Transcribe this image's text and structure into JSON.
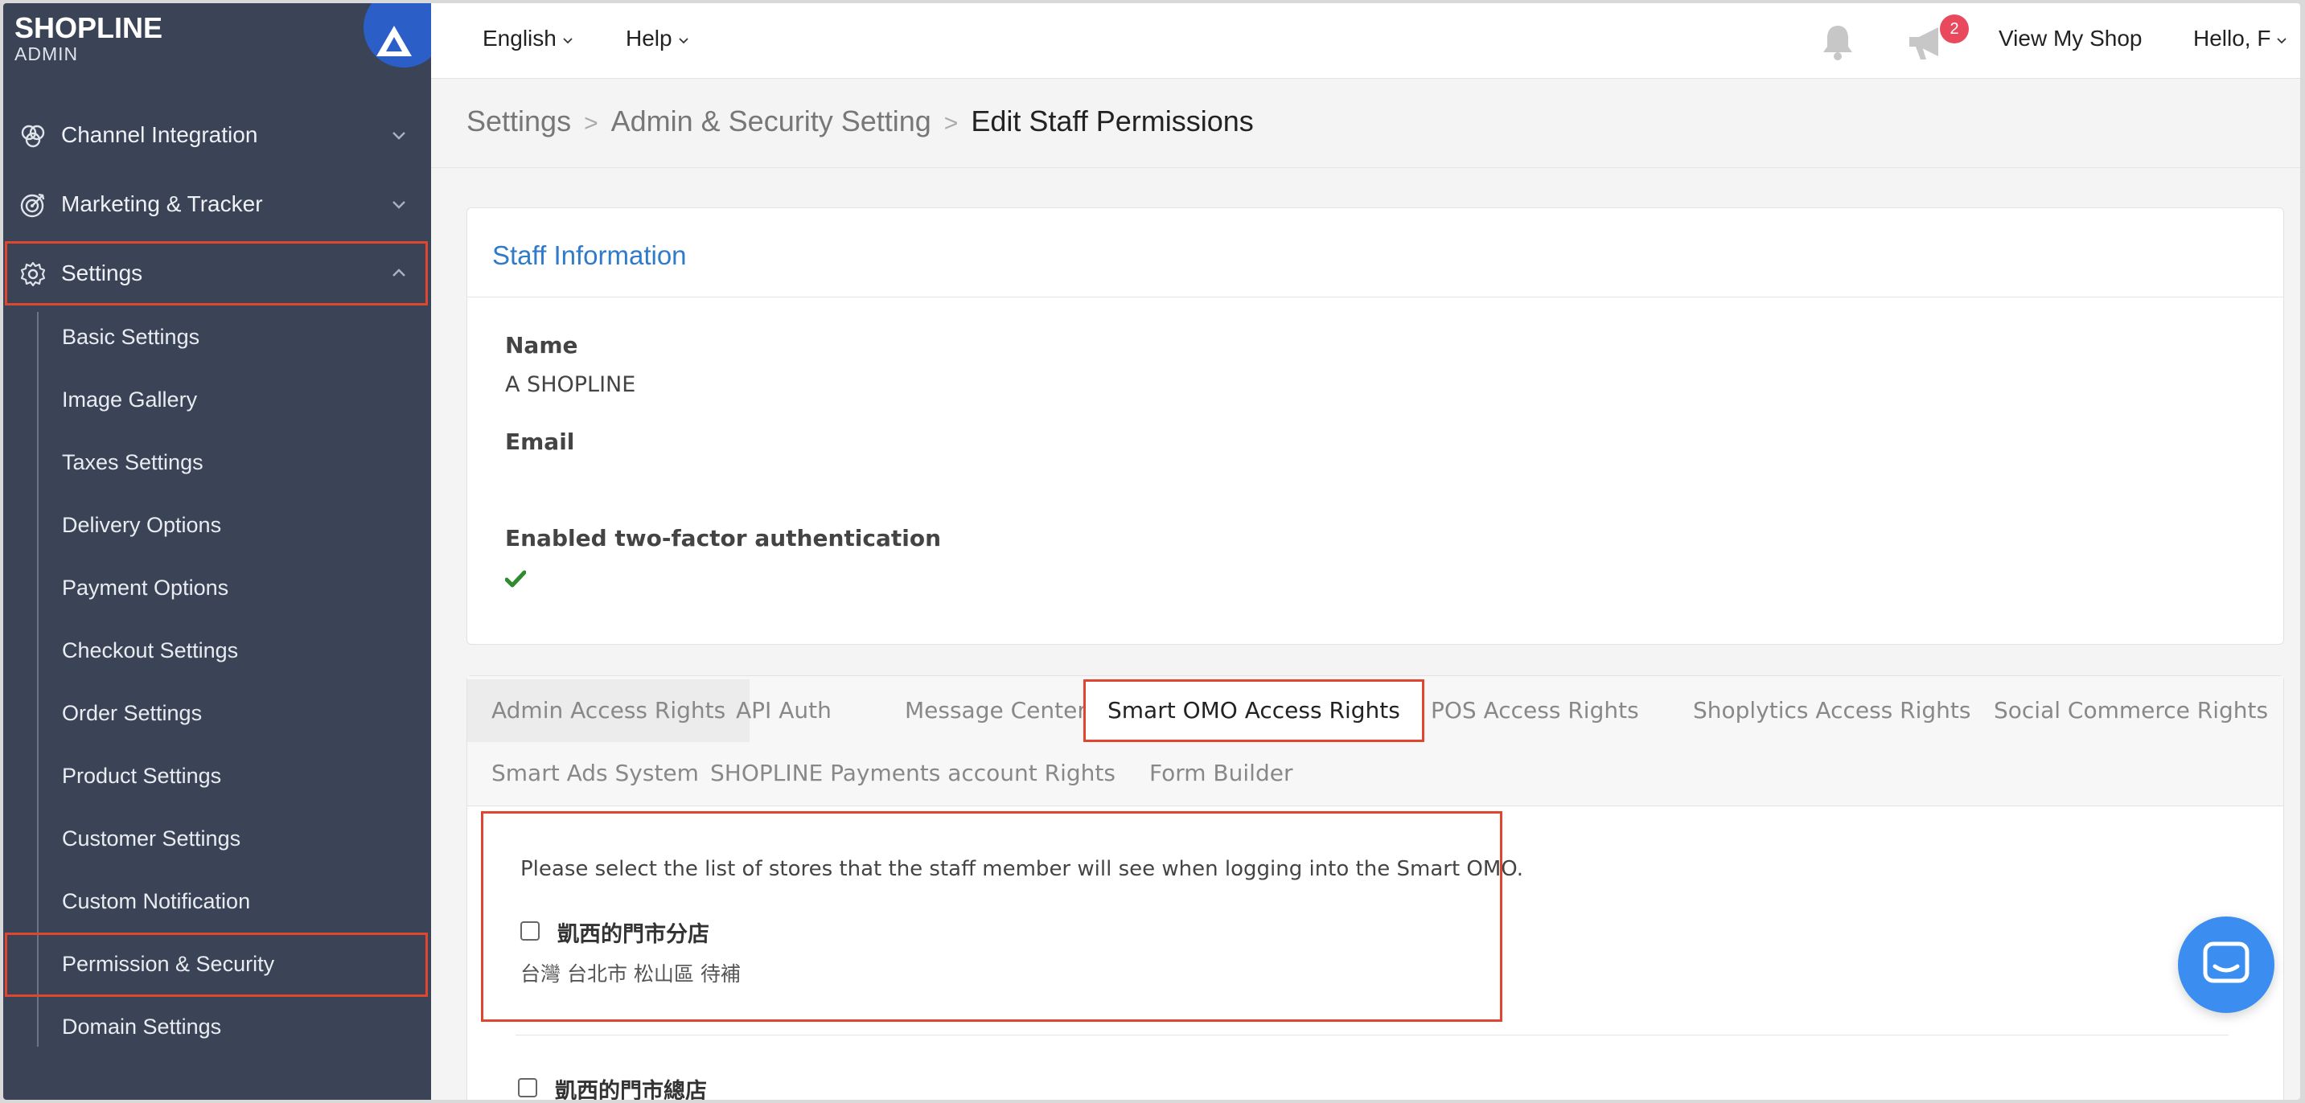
{
  "app": {
    "brand": "SHOPLINE",
    "brand_sub": "ADMIN"
  },
  "sidebar": {
    "sections": [
      {
        "label": "Channel Integration",
        "icon": "channel-integration-icon",
        "expanded": false
      },
      {
        "label": "Marketing & Tracker",
        "icon": "target-icon",
        "expanded": false
      },
      {
        "label": "Settings",
        "icon": "gear-icon",
        "expanded": true
      }
    ],
    "settings_items": [
      {
        "label": "Basic Settings"
      },
      {
        "label": "Image Gallery"
      },
      {
        "label": "Taxes Settings"
      },
      {
        "label": "Delivery Options"
      },
      {
        "label": "Payment Options"
      },
      {
        "label": "Checkout Settings"
      },
      {
        "label": "Order Settings"
      },
      {
        "label": "Product Settings"
      },
      {
        "label": "Customer Settings"
      },
      {
        "label": "Custom Notification"
      },
      {
        "label": "Permission & Security"
      },
      {
        "label": "Domain Settings"
      }
    ]
  },
  "topbar": {
    "language": "English",
    "help": "Help",
    "notification_count": "2",
    "view_shop": "View My Shop",
    "greeting": "Hello, F"
  },
  "breadcrumb": {
    "items": [
      "Settings",
      "Admin & Security Setting",
      "Edit Staff Permissions"
    ],
    "separator": ">"
  },
  "staff_info": {
    "title": "Staff Information",
    "name_label": "Name",
    "name_value": "A SHOPLINE",
    "email_label": "Email",
    "email_value": "",
    "twofa_label": "Enabled two-factor authentication",
    "twofa_enabled": true
  },
  "tabs": {
    "items": [
      {
        "label": "Admin Access Rights"
      },
      {
        "label": "API Auth"
      },
      {
        "label": "Message Center"
      },
      {
        "label": "Smart OMO Access Rights",
        "active": true
      },
      {
        "label": "POS Access Rights"
      },
      {
        "label": "Shoplytics Access Rights"
      },
      {
        "label": "Social Commerce Rights"
      },
      {
        "label": "Smart Ads System"
      },
      {
        "label": "SHOPLINE Payments account Rights"
      },
      {
        "label": "Form Builder"
      }
    ]
  },
  "smart_omo": {
    "description": "Please select the list of stores that the staff member will see when logging into the Smart OMO.",
    "stores": [
      {
        "name": "凱西的門市分店",
        "address": "台灣 台北市 松山區 待補",
        "checked": false
      },
      {
        "name": "凱西的門市總店",
        "checked": false
      }
    ]
  },
  "colors": {
    "sidebar_bg": "#3b4356",
    "accent_blue": "#2f7bc9",
    "highlight_red": "#e0452f",
    "badge_red": "#e9495d",
    "check_green": "#2e8b2e",
    "chat_blue": "#3b8ef0"
  }
}
